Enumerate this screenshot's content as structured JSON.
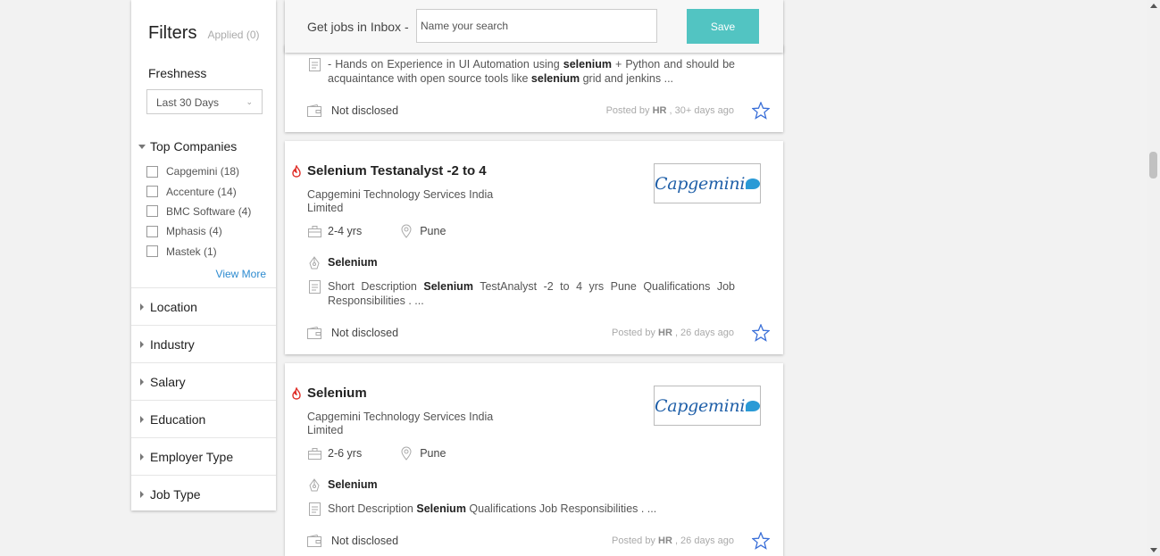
{
  "filters": {
    "title": "Filters",
    "applied": "Applied (0)",
    "freshness_label": "Freshness",
    "freshness_value": "Last 30 Days",
    "top_companies_label": "Top Companies",
    "companies": [
      {
        "label": "Capgemini (18)"
      },
      {
        "label": "Accenture (14)"
      },
      {
        "label": "BMC Software (4)"
      },
      {
        "label": "Mphasis (4)"
      },
      {
        "label": "Mastek (1)"
      }
    ],
    "view_more": "View More",
    "sections": [
      {
        "label": "Location"
      },
      {
        "label": "Industry"
      },
      {
        "label": "Salary"
      },
      {
        "label": "Education"
      },
      {
        "label": "Employer Type"
      },
      {
        "label": "Job Type"
      }
    ]
  },
  "inbox": {
    "label": "Get jobs in Inbox -",
    "placeholder": "Name your search",
    "save_label": "Save"
  },
  "jobs": [
    {
      "desc_pre": "- Hands on Experience in UI Automation using ",
      "desc_b1": "selenium",
      "desc_mid": " + Python and should be acquaintance with open source tools like ",
      "desc_b2": "selenium",
      "desc_post": " grid and jenkins ...",
      "salary": "Not disclosed",
      "posted_pre": "Posted by ",
      "posted_by": "HR",
      "posted_post": " , 30+ days ago"
    },
    {
      "title": "Selenium Testanalyst -2 to 4",
      "company": "Capgemini Technology Services India Limited",
      "logo_text": "Capgemini",
      "experience": "2-4 yrs",
      "location": "Pune",
      "skill": "Selenium",
      "desc_pre": "Short Description ",
      "desc_b1": "Selenium",
      "desc_post": " TestAnalyst -2 to 4 yrs Pune Qualifications Job Responsibilities . ...",
      "salary": "Not disclosed",
      "posted_pre": "Posted by ",
      "posted_by": "HR",
      "posted_post": " , 26 days ago"
    },
    {
      "title": "Selenium",
      "company": "Capgemini Technology Services India Limited",
      "logo_text": "Capgemini",
      "experience": "2-6 yrs",
      "location": "Pune",
      "skill": "Selenium",
      "desc_pre": "Short Description ",
      "desc_b1": "Selenium",
      "desc_post": " Qualifications Job Responsibilities . ...",
      "salary": "Not disclosed",
      "posted_pre": "Posted by ",
      "posted_by": "HR",
      "posted_post": " , 26 days ago"
    }
  ],
  "colors": {
    "accent": "#52c4c2",
    "link": "#2d8bd0",
    "hot": "#e0302a",
    "star": "#3a6fd8"
  }
}
